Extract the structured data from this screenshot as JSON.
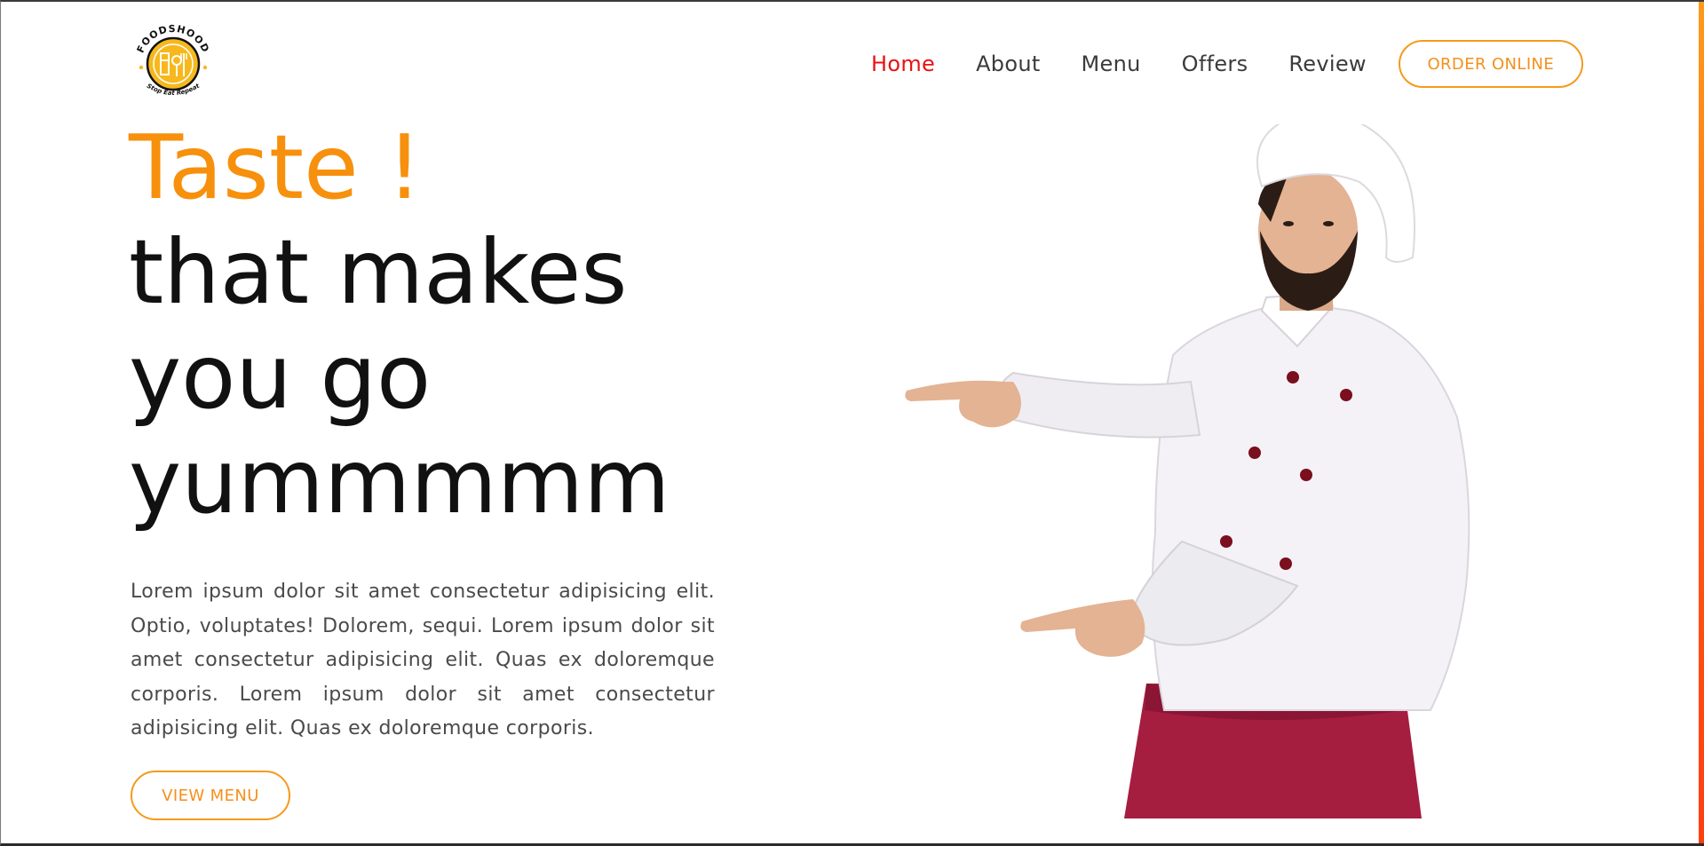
{
  "brand": {
    "name": "FOODSHOOD",
    "tagline": "Stop Eat Repeat",
    "logo_color": "#f7b81d"
  },
  "nav": {
    "items": [
      {
        "label": "Home",
        "active": true
      },
      {
        "label": "About",
        "active": false
      },
      {
        "label": "Menu",
        "active": false
      },
      {
        "label": "Offers",
        "active": false
      },
      {
        "label": "Review",
        "active": false
      }
    ],
    "order_button": "ORDER ONLINE",
    "active_color": "#e81212",
    "accent_color": "#f5901b"
  },
  "hero": {
    "headline_accent": "Taste !",
    "headline_lines": [
      "that makes",
      "you go",
      "yummmmm"
    ],
    "description": "Lorem ipsum dolor sit amet consectetur adipisicing elit. Optio, voluptates! Dolorem, sequi. Lorem ipsum dolor sit amet consectetur adipisicing elit. Quas ex doloremque corporis. Lorem ipsum dolor sit amet consectetur adipisicing elit. Quas ex doloremque corporis.",
    "menu_button": "VIEW MENU",
    "image": "chef-pointing-illustration"
  }
}
